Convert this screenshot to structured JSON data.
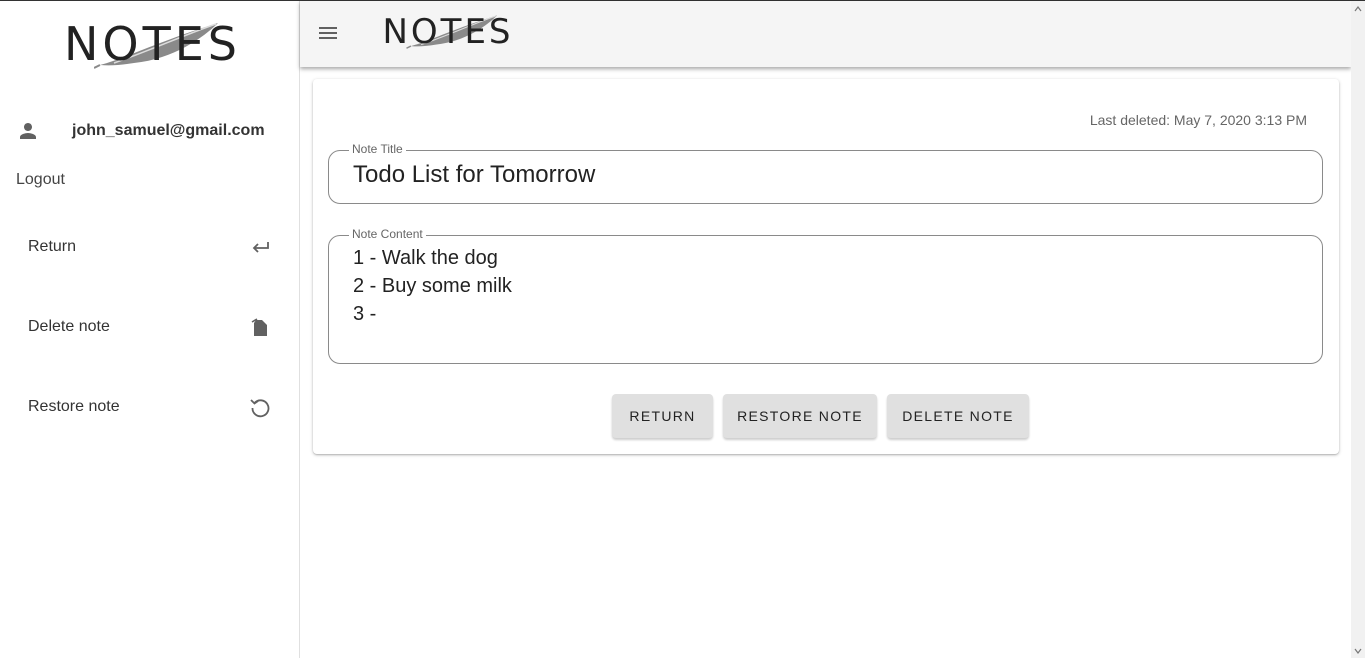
{
  "app": {
    "logo_text": "NOTES"
  },
  "sidebar": {
    "user_email": "john_samuel@gmail.com",
    "logout_label": "Logout",
    "items": [
      {
        "label": "Return",
        "icon": "return-arrow-icon"
      },
      {
        "label": "Delete note",
        "icon": "file-delete-icon"
      },
      {
        "label": "Restore note",
        "icon": "restore-icon"
      }
    ]
  },
  "header": {
    "menu_icon": "hamburger-menu-icon",
    "logo_text": "NOTES"
  },
  "note": {
    "last_deleted": "Last deleted: May 7, 2020 3:13 PM",
    "title_label": "Note Title",
    "title_value": "Todo List for Tomorrow",
    "content_label": "Note Content",
    "content_lines": [
      "1 - Walk the dog",
      "2 - Buy some milk",
      "3 -"
    ]
  },
  "actions": {
    "return_label": "RETURN",
    "restore_label": "RESTORE NOTE",
    "delete_label": "DELETE NOTE"
  },
  "colors": {
    "topbar_bg": "#f5f5f5",
    "button_bg": "#e0e0e0",
    "icon_gray": "#616161"
  }
}
